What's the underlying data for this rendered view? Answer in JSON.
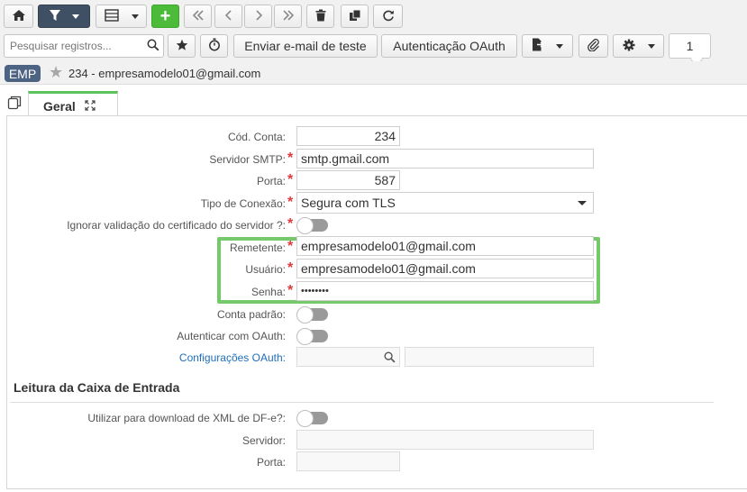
{
  "toolbar": {
    "search_placeholder": "Pesquisar registros...",
    "send_test_email_label": "Enviar e-mail de teste",
    "oauth_auth_label": "Autenticação OAuth",
    "page_number": "1"
  },
  "record": {
    "badge": "EMP",
    "title": "234 - empresamodelo01@gmail.com"
  },
  "tabs": [
    {
      "label": "Geral",
      "active": true
    }
  ],
  "form": {
    "cod_conta": {
      "label": "Cód. Conta:",
      "value": "234"
    },
    "servidor_smtp": {
      "label": "Servidor SMTP:",
      "value": "smtp.gmail.com",
      "required": true
    },
    "porta": {
      "label": "Porta:",
      "value": "587",
      "required": true
    },
    "tipo_conexao": {
      "label": "Tipo de Conexão:",
      "value": "Segura com TLS",
      "required": true
    },
    "ignorar_certificado": {
      "label": "Ignorar validação do certificado do servidor ?:",
      "value": false,
      "required": true
    },
    "remetente": {
      "label": "Remetente:",
      "value": "empresamodelo01@gmail.com",
      "required": true
    },
    "usuario": {
      "label": "Usuário:",
      "value": "empresamodelo01@gmail.com",
      "required": true
    },
    "senha": {
      "label": "Senha:",
      "value": "••••••••",
      "required": true
    },
    "conta_padrao": {
      "label": "Conta padrão:",
      "value": false
    },
    "autenticar_oauth": {
      "label": "Autenticar com OAuth:",
      "value": false
    },
    "config_oauth": {
      "label": "Configurações OAuth:",
      "value": ""
    }
  },
  "inbox_section": {
    "title": "Leitura da Caixa de Entrada",
    "download_xml": {
      "label": "Utilizar para download de XML de DF-e?:",
      "value": false
    },
    "servidor": {
      "label": "Servidor:",
      "value": ""
    },
    "porta": {
      "label": "Porta:",
      "value": ""
    }
  },
  "colors": {
    "accent_green": "#4cbb3a",
    "highlight_green": "#76c96a",
    "dark_button": "#3f5064",
    "badge": "#4d6384",
    "required": "#e03a3a",
    "link": "#1f6fbd"
  }
}
